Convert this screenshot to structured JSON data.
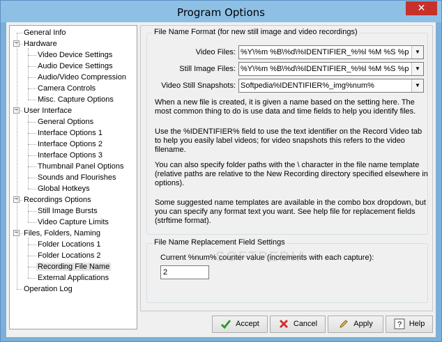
{
  "window": {
    "title": "Program Options",
    "close_glyph": "✕"
  },
  "tree": [
    {
      "label": "General Info",
      "level": 0
    },
    {
      "label": "Hardware",
      "level": 0,
      "expander": "−"
    },
    {
      "label": "Video Device Settings",
      "level": 1
    },
    {
      "label": "Audio Device Settings",
      "level": 1
    },
    {
      "label": "Audio/Video Compression",
      "level": 1
    },
    {
      "label": "Camera Controls",
      "level": 1
    },
    {
      "label": "Misc. Capture Options",
      "level": 1
    },
    {
      "label": "User Interface",
      "level": 0,
      "expander": "−"
    },
    {
      "label": "General Options",
      "level": 1
    },
    {
      "label": "Interface Options 1",
      "level": 1
    },
    {
      "label": "Interface Options 2",
      "level": 1
    },
    {
      "label": "Interface Options 3",
      "level": 1
    },
    {
      "label": "Thumbnail Panel Options",
      "level": 1
    },
    {
      "label": "Sounds and Flourishes",
      "level": 1
    },
    {
      "label": "Global Hotkeys",
      "level": 1
    },
    {
      "label": "Recordings Options",
      "level": 0,
      "expander": "−"
    },
    {
      "label": "Still Image Bursts",
      "level": 1
    },
    {
      "label": "Video Capture Limits",
      "level": 1
    },
    {
      "label": "Files, Folders, Naming",
      "level": 0,
      "expander": "−"
    },
    {
      "label": "Folder Locations 1",
      "level": 1
    },
    {
      "label": "Folder Locations 2",
      "level": 1
    },
    {
      "label": "Recording File Name",
      "level": 1,
      "selected": true
    },
    {
      "label": "External Applications",
      "level": 1
    },
    {
      "label": "Operation Log",
      "level": 0
    }
  ],
  "file_name_format": {
    "title": "File Name Format (for new still image and video recordings)",
    "video_files_label": "Video Files:",
    "video_files_value": "%Y\\%m %B\\%d\\%IDENTIFIER_%%l %M %S %p",
    "still_image_label": "Still Image Files:",
    "still_image_value": "%Y\\%m %B\\%d\\%IDENTIFIER_%%l %M %S %p",
    "snapshot_label": "Video Still Snapshots:",
    "snapshot_value": "Softpedia%IDENTIFIER%_img%num%",
    "paragraphs": [
      "When a new file is created, it is given a name based on the setting here.  The most common thing to do is use data and time fields to help you identify files.",
      "Use the %IDENTIFIER% field to use the text identifier on the Record Video tab to help you easily label videos; for video snapshots this refers to the video filename.",
      "You can also specify folder paths with the \\ character in the file name template (relative paths are relative to the New Recording directory specified elsewhere in options).",
      "Some suggested name templates are available in the combo box dropdown, but you can specify any format text you want.  See help file for replacement fields (strftime format)."
    ]
  },
  "replacement": {
    "title": "File Name Replacement Field Settings",
    "counter_label": "Current %num% counter value (increments with each capture):",
    "counter_value": "2"
  },
  "buttons": {
    "accept": "Accept",
    "cancel": "Cancel",
    "apply": "Apply",
    "help": "Help"
  },
  "watermark": "SOFTPEDIA"
}
